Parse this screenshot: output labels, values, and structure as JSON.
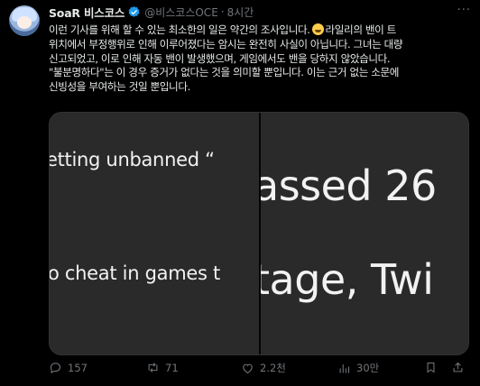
{
  "author": {
    "name": "SoaR 비스코스",
    "handle": "@비스코스OCE",
    "separator": "·",
    "time": "8시간",
    "more_label": "···"
  },
  "tweet": {
    "line1a": "이런 기사를 위해 할 수 있는 최소한의 일은 약간의 조사입니다.",
    "line1b": "라일리의 밴이 트",
    "line2": "위치에서 부정행위로 인해 이루어졌다는 암시는 완전히 사실이 아닙니다. 그녀는 대량",
    "line3": "신고되었고, 이로 인해 자동 밴이 발생했으며, 게임에서도 밴을 당하지 않았습니다.",
    "line4": "\"불분명하다\"는 이 경우 증거가 없다는 것을 의미할 뿐입니다. 이는 근거 없는 소문에",
    "line5": "신빙성을 부여하는 것일 뿐입니다."
  },
  "media": {
    "left_text_1": "etting unbanned “",
    "left_text_2": "o cheat in games t",
    "right_text_1": "assed 26",
    "right_text_2": "tage, Twi"
  },
  "actions": {
    "replies": "157",
    "reposts": "71",
    "likes": "2.2천",
    "views": "30만"
  },
  "colors": {
    "background": "#000000",
    "text": "#e7e9ea",
    "muted": "#71767b",
    "verified": "#1d9bf0"
  }
}
